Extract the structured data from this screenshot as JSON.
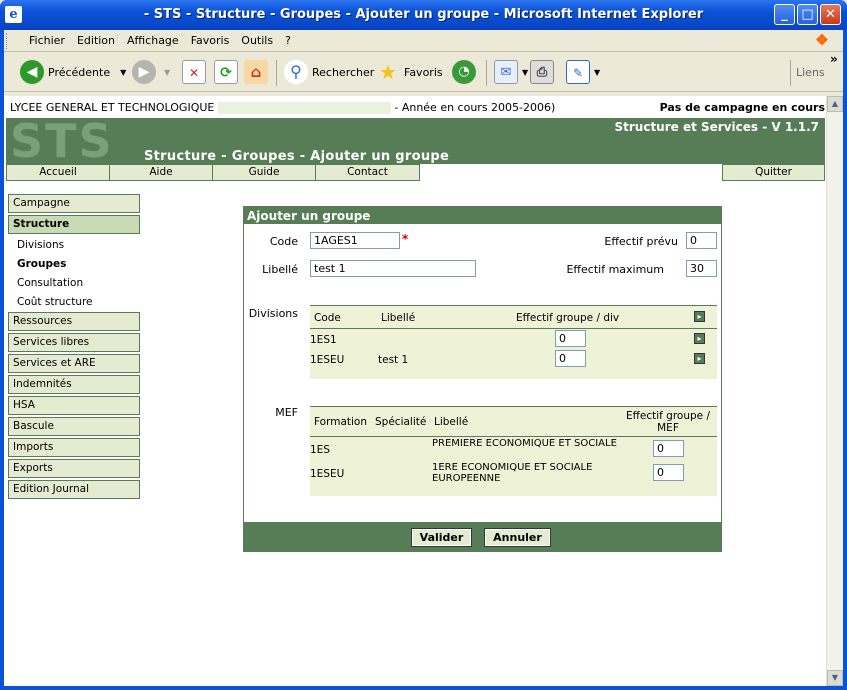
{
  "window": {
    "title": "- STS - Structure - Groupes - Ajouter un groupe - Microsoft Internet Explorer",
    "controls": {
      "minimize": "_",
      "maximize": "□",
      "close": "✕"
    }
  },
  "menu": [
    "Fichier",
    "Edition",
    "Affichage",
    "Favoris",
    "Outils",
    "?"
  ],
  "toolbar": {
    "back": "Précédente",
    "search": "Rechercher",
    "favorites": "Favoris",
    "links": "Liens",
    "links_more": "»"
  },
  "page": {
    "school": "LYCEE GENERAL ET TECHNOLOGIQUE",
    "year": "- Année en cours 2005-2006)",
    "campaign": "Pas de campagne en cours",
    "logo": "STS",
    "version": "Structure et Services - V 1.1.7",
    "page_title": "Structure - Groupes - Ajouter un groupe",
    "nav": [
      "Accueil",
      "Aide",
      "Guide",
      "Contact"
    ],
    "quit": "Quitter"
  },
  "sidebar": {
    "campagne": "Campagne",
    "structure": "Structure",
    "sub": [
      "Divisions",
      "Groupes",
      "Consultation",
      "Coût structure"
    ],
    "items": [
      "Ressources",
      "Services libres",
      "Services et ARE",
      "Indemnités",
      "HSA",
      "Bascule",
      "Imports",
      "Exports",
      "Edition Journal"
    ]
  },
  "form": {
    "header": "Ajouter un groupe",
    "code_label": "Code",
    "code_value": "1AGES1",
    "required_mark": "*",
    "libelle_label": "Libellé",
    "libelle_value": "test 1",
    "effectif_prevu_label": "Effectif prévu",
    "effectif_prevu_value": "0",
    "effectif_max_label": "Effectif maximum",
    "effectif_max_value": "30",
    "divisions_label": "Divisions",
    "divisions_table": {
      "headers": [
        "Code",
        "Libellé",
        "Effectif groupe / div"
      ],
      "rows": [
        {
          "code": "1ES1",
          "libelle": "",
          "effectif": "0"
        },
        {
          "code": "1ESEU",
          "libelle": "test 1",
          "effectif": "0"
        }
      ]
    },
    "mef_label": "MEF",
    "mef_table": {
      "headers": [
        "Formation",
        "Spécialité",
        "Libellé",
        "Effectif groupe / MEF"
      ],
      "rows": [
        {
          "formation": "1ES",
          "specialite": "",
          "libelle": "PREMIERE ECONOMIQUE ET SOCIALE",
          "effectif": "0"
        },
        {
          "formation": "1ESEU",
          "specialite": "",
          "libelle": "1ERE ECONOMIQUE ET SOCIALE EUROPEENNE",
          "effectif": "0"
        }
      ]
    },
    "valider": "Valider",
    "annuler": "Annuler"
  }
}
